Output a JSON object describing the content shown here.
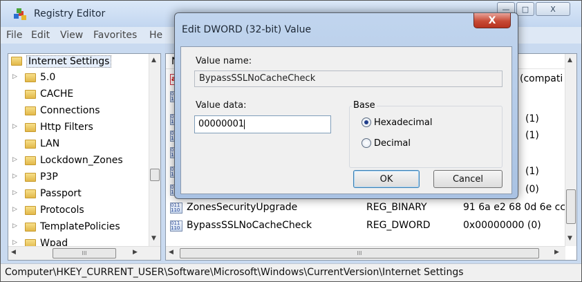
{
  "window": {
    "title": "Registry Editor",
    "minimize_glyph": "—",
    "maximize_glyph": "□",
    "close_glyph": "X"
  },
  "menu": [
    "File",
    "Edit",
    "View",
    "Favorites",
    "He"
  ],
  "tree": {
    "selected": "Internet Settings",
    "items": [
      {
        "label": "Internet Settings",
        "expander": ""
      },
      {
        "label": "5.0",
        "expander": "▷"
      },
      {
        "label": "CACHE",
        "expander": ""
      },
      {
        "label": "Connections",
        "expander": ""
      },
      {
        "label": "Http Filters",
        "expander": "▷"
      },
      {
        "label": "LAN",
        "expander": ""
      },
      {
        "label": "Lockdown_Zones",
        "expander": "▷"
      },
      {
        "label": "P3P",
        "expander": "▷"
      },
      {
        "label": "Passport",
        "expander": "▷"
      },
      {
        "label": "Protocols",
        "expander": "▷"
      },
      {
        "label": "TemplatePolicies",
        "expander": "▷"
      },
      {
        "label": "Wpad",
        "expander": "▷"
      }
    ],
    "hscroll_thumb": "III"
  },
  "values_pane": {
    "header_name": "Na",
    "rows": [
      {
        "icon": "ab",
        "name": "",
        "type": "",
        "data": "(compati"
      },
      {
        "icon": "bin",
        "name": "",
        "type": "",
        "data": ""
      },
      {
        "icon": "bin",
        "name": "",
        "type": "",
        "data": "(1)"
      },
      {
        "icon": "bin",
        "name": "",
        "type": "",
        "data": "(1)"
      },
      {
        "icon": "bin",
        "name": "",
        "type": "",
        "data": ""
      },
      {
        "icon": "bin",
        "name": "",
        "type": "",
        "data": "(1)"
      },
      {
        "icon": "bin",
        "name": "",
        "type": "",
        "data": "(0)"
      },
      {
        "icon": "bin",
        "name": "ZonesSecurityUpgrade",
        "type": "REG_BINARY",
        "data": "91 6a e2 68 0d 6e cc"
      },
      {
        "icon": "bin",
        "name": "BypassSSLNoCacheCheck",
        "type": "REG_DWORD",
        "data": "0x00000000 (0)"
      }
    ],
    "hscroll_thumb": "III"
  },
  "status": {
    "path": "Computer\\HKEY_CURRENT_USER\\Software\\Microsoft\\Windows\\CurrentVersion\\Internet Settings"
  },
  "dialog": {
    "title": "Edit DWORD (32-bit) Value",
    "close_glyph": "X",
    "value_name_label": "Value name:",
    "value_name": "BypassSSLNoCacheCheck",
    "value_data_label": "Value data:",
    "value_data": "00000001",
    "base_label": "Base",
    "base_options": [
      "Hexadecimal",
      "Decimal"
    ],
    "base_selected": "Hexadecimal",
    "ok_label": "OK",
    "cancel_label": "Cancel"
  }
}
